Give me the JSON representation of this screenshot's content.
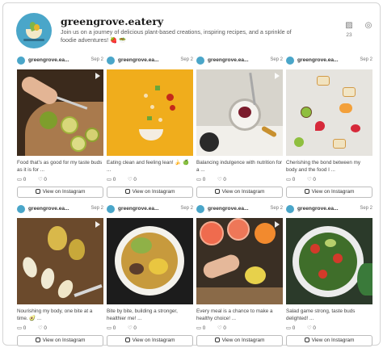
{
  "profile": {
    "name": "greengrove.eatery",
    "bio": "Join us on a journey of delicious plant-based creations, inspiring recipes, and a sprinkle of foodie adventures! 🍓 🥗",
    "posts_count": "23",
    "posts_icon": "image-icon",
    "follow_icon": "instagram-icon"
  },
  "posts": [
    {
      "handle": "greengrove.ea...",
      "date": "Sep 2",
      "caption": "Food that’s as good for my taste buds as it is for ...",
      "comments": "0",
      "likes": "0",
      "button": "View on Instagram"
    },
    {
      "handle": "greengrove.ea...",
      "date": "Sep 2",
      "caption": "Eating clean and feeling lean! 🍌 🍏 ...",
      "comments": "0",
      "likes": "0",
      "button": "View on Instagram"
    },
    {
      "handle": "greengrove.ea...",
      "date": "Sep 2",
      "caption": "Balancing indulgence with nutrition for a ...",
      "comments": "0",
      "likes": "0",
      "button": "View on Instagram"
    },
    {
      "handle": "greengrove.ea...",
      "date": "Sep 2",
      "caption": "Cherishing the bond between my body and the food I ...",
      "comments": "0",
      "likes": "0",
      "button": "View on Instagram"
    },
    {
      "handle": "greengrove.ea...",
      "date": "Sep 2",
      "caption": "Nourishing my body, one bite at a time. 🥑 ...",
      "comments": "0",
      "likes": "0",
      "button": "View on Instagram"
    },
    {
      "handle": "greengrove.ea...",
      "date": "Sep 2",
      "caption": "Bite by bite, building a stronger, healthier me! ...",
      "comments": "0",
      "likes": "0",
      "button": "View on Instagram"
    },
    {
      "handle": "greengrove.ea...",
      "date": "Sep 2",
      "caption": "Every meal is a chance to make a healthy choice! ...",
      "comments": "0",
      "likes": "0",
      "button": "View on Instagram"
    },
    {
      "handle": "greengrove.ea...",
      "date": "Sep 2",
      "caption": "Salad game strong, taste buds delighted! ...",
      "comments": "0",
      "likes": "0",
      "button": "View on Instagram"
    }
  ]
}
